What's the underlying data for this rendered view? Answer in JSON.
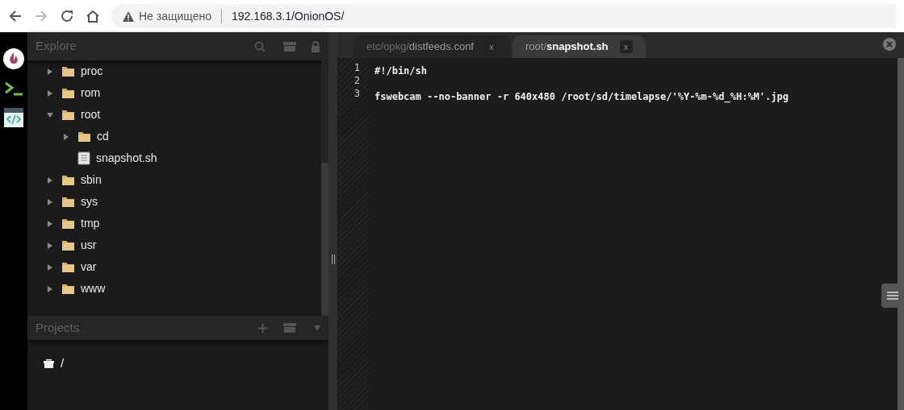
{
  "browser": {
    "security": "Не защищено",
    "url": "192.168.3.1/OnionOS/"
  },
  "explorer": {
    "title": "Explore",
    "tree": [
      {
        "kind": "folder",
        "label": "proc",
        "expanded": false
      },
      {
        "kind": "folder",
        "label": "rom",
        "expanded": false
      },
      {
        "kind": "folder",
        "label": "root",
        "expanded": true,
        "children": [
          {
            "kind": "folder",
            "label": "cd",
            "expanded": false
          },
          {
            "kind": "file",
            "label": "snapshot.sh"
          }
        ]
      },
      {
        "kind": "folder",
        "label": "sbin",
        "expanded": false
      },
      {
        "kind": "folder",
        "label": "sys",
        "expanded": false
      },
      {
        "kind": "folder",
        "label": "tmp",
        "expanded": false
      },
      {
        "kind": "folder",
        "label": "usr",
        "expanded": false
      },
      {
        "kind": "folder",
        "label": "var",
        "expanded": false
      },
      {
        "kind": "folder",
        "label": "www",
        "expanded": false
      }
    ]
  },
  "projects": {
    "title": "Projects",
    "items": [
      {
        "label": "/"
      }
    ]
  },
  "editor": {
    "tabs": [
      {
        "label": "etc/opkg/**distfeeds.conf**",
        "close": "x",
        "selected": false
      },
      {
        "label": "root/**snapshot.sh**",
        "close": "x",
        "selected": true
      }
    ],
    "lines": [
      {
        "number": "1",
        "code": "#!/bin/sh"
      },
      {
        "number": "2"
      },
      {
        "number": "3",
        "code": "fswebcam --no-banner -r 640x480 /root/sd/timelapse/'%Y-%m-%d_%H:%M'.jpg"
      }
    ]
  }
}
